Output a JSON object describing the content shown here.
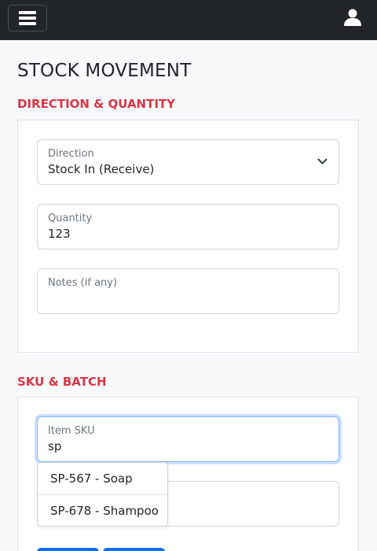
{
  "nav": {
    "menu_icon": "hamburger-icon",
    "user_icon": "user-icon"
  },
  "page": {
    "title": "STOCK MOVEMENT"
  },
  "direction_section": {
    "title": "DIRECTION & QUANTITY",
    "direction": {
      "label": "Direction",
      "value": "Stock In (Receive)"
    },
    "quantity": {
      "label": "Quantity",
      "value": "123"
    },
    "notes": {
      "label": "Notes (if any)",
      "value": ""
    }
  },
  "sku_section": {
    "title": "SKU & BATCH",
    "item_sku": {
      "label": "Item SKU",
      "value": "sp"
    },
    "suggestions": [
      "SP-567 - Soap",
      "SP-678 - Shampoo"
    ]
  },
  "colors": {
    "navbar": "#212529",
    "accent_red": "#dc3545",
    "primary": "#0d6efd",
    "focus_border": "#86b7fe"
  }
}
